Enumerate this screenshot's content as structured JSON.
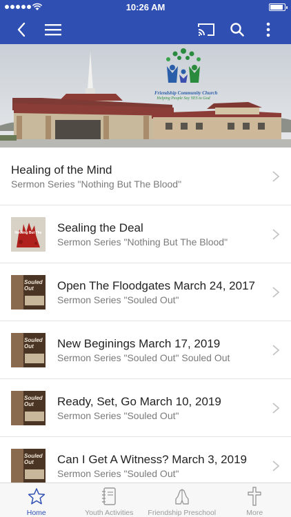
{
  "status_bar": {
    "time": "10:26 AM"
  },
  "banner": {
    "logo_text": "Friendship Community Church",
    "tagline": "Helping People Say YES to God"
  },
  "sermons": [
    {
      "title": "Healing of the Mind",
      "subtitle": "Sermon Series \"Nothing But The Blood\"",
      "thumb": "none"
    },
    {
      "title": "Sealing the Deal",
      "subtitle": "Sermon Series \"Nothing But The Blood\"",
      "thumb": "blood"
    },
    {
      "title": "Open The Floodgates March 24, 2017",
      "subtitle": "Sermon Series \"Souled Out\"",
      "thumb": "souled-out"
    },
    {
      "title": "New Beginings March 17, 2019",
      "subtitle": "Sermon Series \"Souled Out\" Souled Out",
      "thumb": "souled-out"
    },
    {
      "title": "Ready, Set, Go March 10, 2019",
      "subtitle": "Sermon Series \"Souled Out\"",
      "thumb": "souled-out"
    },
    {
      "title": "Can I Get A Witness?  March 3, 2019",
      "subtitle": "Sermon Series \"Souled Out\"",
      "thumb": "souled-out"
    }
  ],
  "thumbs": {
    "souled_out_line1": "Souled",
    "souled_out_line2": "Out",
    "blood_label": "Nothing But The"
  },
  "tabs": [
    {
      "label": "Home",
      "icon": "star-icon",
      "active": true
    },
    {
      "label": "Youth Activities",
      "icon": "notebook-icon",
      "active": false
    },
    {
      "label": "Friendship Preschool",
      "icon": "praying-hands-icon",
      "active": false
    },
    {
      "label": "More",
      "icon": "cross-icon",
      "active": false
    }
  ],
  "colors": {
    "brand": "#2f4fb3",
    "tab_inactive": "#9a9a9a"
  }
}
